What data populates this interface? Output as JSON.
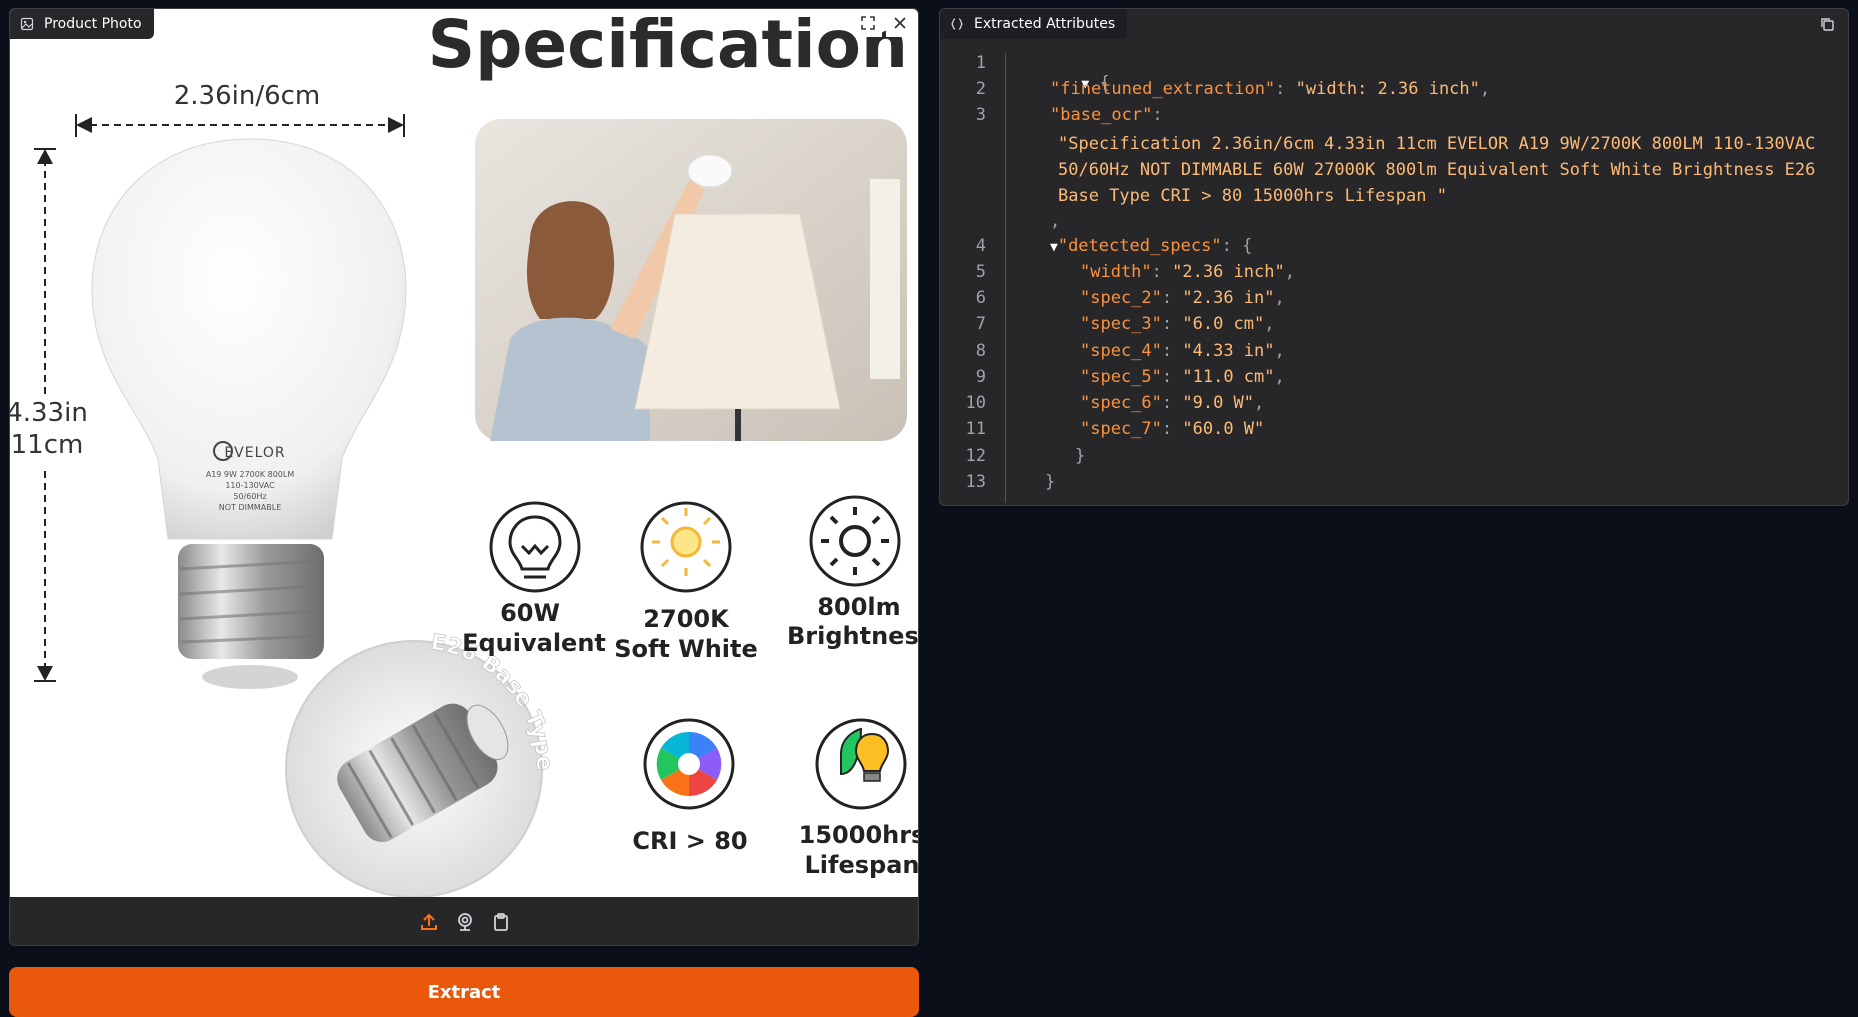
{
  "left_panel": {
    "label": "Product Photo",
    "image": {
      "title": "Specification",
      "width_dim": "2.36in/6cm",
      "height_dim_in": "4.33in",
      "height_dim_cm": "11cm",
      "brand": "EVELOR",
      "bulb_lines": [
        "A19 9W 2700K 800LM",
        "110-130VAC",
        "50/60Hz",
        "NOT DIMMABLE"
      ],
      "base_text": "E26 Base Type",
      "features": [
        {
          "line1": "60W",
          "line2": "Equivalent",
          "icon": "lightbulb-icon"
        },
        {
          "line1": "2700K",
          "line2": "Soft White",
          "icon": "sun-bulb-icon"
        },
        {
          "line1": "800lm",
          "line2": "Brightness",
          "icon": "sun-icon"
        },
        {
          "line1": "CRI > 80",
          "line2": "",
          "icon": "color-aperture-icon"
        },
        {
          "line1": "15000hrs",
          "line2": "Lifespan",
          "icon": "leaf-bulb-icon"
        }
      ]
    },
    "toolbar": [
      "upload-icon",
      "webcam-icon",
      "clipboard-icon"
    ]
  },
  "extract_button": {
    "label": "Extract"
  },
  "right_panel": {
    "label": "Extracted Attributes",
    "line_numbers": [
      "1",
      "2",
      "3",
      "4",
      "5",
      "6",
      "7",
      "8",
      "9",
      "10",
      "11",
      "12",
      "13"
    ],
    "json": {
      "open_brace": "{",
      "finetuned_key": "\"finetuned_extraction\"",
      "finetuned_value": "\"width: 2.36 inch\"",
      "base_ocr_key": "\"base_ocr\"",
      "base_ocr_value": "\"Specification 2.36in/6cm 4.33in 11cm EVELOR A19 9W/2700K 800LM 110-130VAC 50/60Hz NOT DIMMABLE 60W 27000K 800lm Equivalent Soft White Brightness E26 Base Type CRI > 80 15000hrs Lifespan \"",
      "detected_key": "\"detected_specs\"",
      "specs": [
        {
          "key": "\"width\"",
          "value": "\"2.36 inch\""
        },
        {
          "key": "\"spec_2\"",
          "value": "\"2.36 in\""
        },
        {
          "key": "\"spec_3\"",
          "value": "\"6.0 cm\""
        },
        {
          "key": "\"spec_4\"",
          "value": "\"4.33 in\""
        },
        {
          "key": "\"spec_5\"",
          "value": "\"11.0 cm\""
        },
        {
          "key": "\"spec_6\"",
          "value": "\"9.0 W\""
        },
        {
          "key": "\"spec_7\"",
          "value": "\"60.0 W\""
        }
      ],
      "close_inner": "}",
      "close_outer": "}"
    }
  },
  "colors": {
    "accent": "#ea580c",
    "key": "#fb923c",
    "string": "#fdba74",
    "background": "#0b0f19",
    "panel": "#27272a"
  }
}
